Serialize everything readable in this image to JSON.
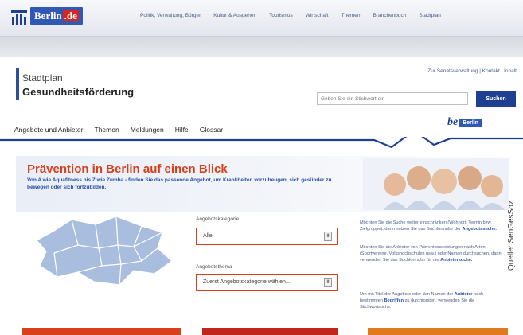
{
  "brand": {
    "logo_text": "Berlin",
    "logo_suffix": ".de"
  },
  "topnav": [
    "Politik, Verwaltung, Bürger",
    "Kultur & Ausgehen",
    "Tourismus",
    "Wirtschaft",
    "Themen",
    "Branchenbuch",
    "Stadtplan"
  ],
  "header": {
    "stadtplan": "Stadtplan",
    "section_title": "Gesundheitsförderung",
    "service_links": "Zur Senatsverwaltung | Kontakt | Inhalt",
    "search_placeholder": "Geben Sie ein Stichwort ein",
    "search_button": "Suchen"
  },
  "mainnav": [
    "Angebote und Anbieter",
    "Themen",
    "Meldungen",
    "Hilfe",
    "Glossar"
  ],
  "be_logo": {
    "be": "be",
    "berlin": "Berlin"
  },
  "hero": {
    "title": "Prävention in Berlin auf einen Blick",
    "text": "Von A wie Aquafitness bis Z wie Zumba - finden Sie das passende Angebot, um Krankheiten vorzubeugen, sich gesünder zu bewegen oder sich fortzubilden."
  },
  "form": {
    "category_label": "Angebotskategorie",
    "category_value": "Alle",
    "topic_label": "Angebotsthema",
    "topic_value": "Zuerst Angebotskategorie wählen...",
    "arrow": "⇟"
  },
  "info": {
    "p1": "Möchten Sie die Suche weiter einschränken (Wohnort, Termin bzw. Zielgruppe), dann nutzen Sie das Suchformular der",
    "p1_link": "Angebotssuche.",
    "p2": "Möchten Sie die Anbieter von Präventionsleistungen nach Arten (Sportvereine, Volkshochschulen usw.) oder Namen durchsuchen, dann verwenden Sie das Suchformular für die",
    "p2_link": "Anbietersuche.",
    "p3": "Um mit Titel der Angebote oder den Namen der",
    "p3_link1": "Anbieter",
    "p3_mid": "nach bestimmten",
    "p3_link2": "Begriffen",
    "p3_end": "zu durchforsten, verwenden Sie die Stichwortsuche."
  },
  "source_credit": "Quelle: SenGesSoz",
  "colors": {
    "accent": "#d8401c",
    "brand_blue": "#1f3f91",
    "map_blue": "#a9bede"
  }
}
